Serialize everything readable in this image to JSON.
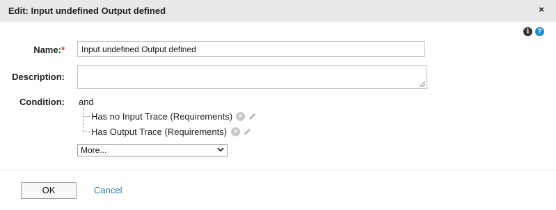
{
  "dialog": {
    "title": "Edit: Input undefined Output defined",
    "close_glyph": "×"
  },
  "icons": {
    "info": "info-icon",
    "help": "help-icon",
    "remove": "remove-circle-icon",
    "edit": "pencil-icon",
    "chevron": "chevron-down-icon"
  },
  "form": {
    "name_label": "Name:",
    "required_marker": "*",
    "name_value": "Input undefined Output defined",
    "description_label": "Description:",
    "description_value": "",
    "condition_label": "Condition:",
    "condition_operator": "and",
    "conditions": [
      {
        "label": "Has no Input Trace (Requirements)"
      },
      {
        "label": "Has Output Trace (Requirements)"
      }
    ],
    "more_select": "More..."
  },
  "footer": {
    "ok_label": "OK",
    "cancel_label": "Cancel"
  },
  "colors": {
    "titlebar_bg": "#e8e8e8",
    "link": "#2a7ab8",
    "required": "#c0392b",
    "help_blue": "#1b8fd1"
  }
}
